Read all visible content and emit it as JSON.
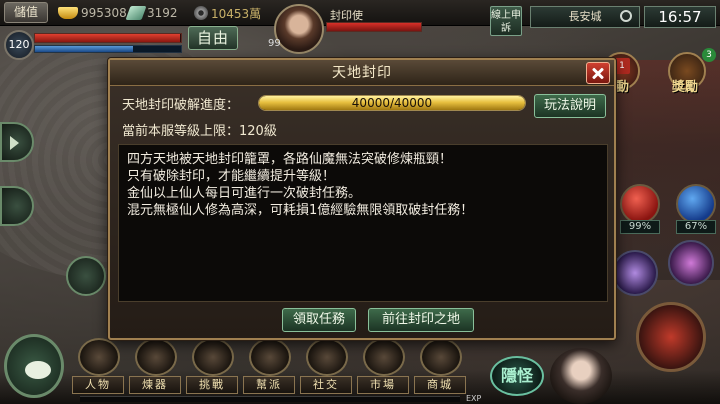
{
  "hud": {
    "recharge_label": "儲值",
    "gold": "995308",
    "jade": "3192",
    "coins": "10453萬",
    "player_level": "120",
    "auto_label": "自由",
    "target_name": "封印使",
    "target_level": "99",
    "report_label": "線上申訴",
    "location": "長安城",
    "clock": "16:57"
  },
  "right_panel": {
    "activity_label": "動",
    "reward_label": "獎勵",
    "activity_badge": "1",
    "reward_badge": "3",
    "hp_pct": "99%",
    "mp_pct": "67%"
  },
  "dialog": {
    "title": "天地封印",
    "progress_label": "天地封印破解進度：",
    "progress_text": "40000/40000",
    "progress_fraction": 1.0,
    "rules_button": "玩法說明",
    "level_cap": "當前本服等級上限：120級",
    "description": [
      "四方天地被天地封印籠罩，各路仙魔無法突破修煉瓶頸！",
      "只有破除封印，才能繼續提升等級！",
      "金仙以上仙人每日可進行一次破封任務。",
      "混元無極仙人修為高深，可耗損1億經驗無限領取破封任務！"
    ],
    "accept_task_button": "領取任務",
    "goto_button": "前往封印之地"
  },
  "bottom_menu": {
    "items": [
      {
        "label": "人物",
        "icon": "character-icon"
      },
      {
        "label": "煉器",
        "icon": "forge-icon"
      },
      {
        "label": "挑戰",
        "icon": "challenge-icon"
      },
      {
        "label": "幫派",
        "icon": "guild-icon"
      },
      {
        "label": "社交",
        "icon": "social-icon"
      },
      {
        "label": "市場",
        "icon": "market-icon"
      },
      {
        "label": "商城",
        "icon": "shop-icon"
      }
    ],
    "hide_label": "隱怪",
    "exp_label": "EXP"
  }
}
